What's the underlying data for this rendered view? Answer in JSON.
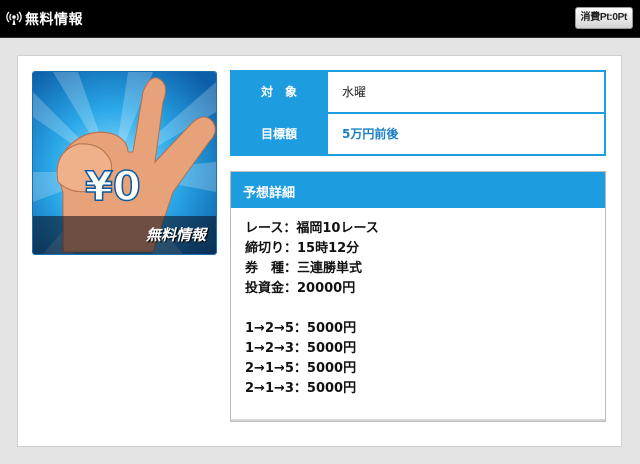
{
  "header": {
    "title": "無料情報",
    "points_badge": "消費Pt:0Pt"
  },
  "image": {
    "caption": "無料情報",
    "hand_text": "¥0"
  },
  "info": {
    "rows": [
      {
        "label": "対　象",
        "value": "水曜"
      },
      {
        "label": "目標額",
        "value": "5万円前後"
      }
    ]
  },
  "detail": {
    "heading": "予想詳細",
    "race": "レース：福岡10レース",
    "deadline": "締切り：15時12分",
    "ticket_type": "券　種：三連勝単式",
    "investment": "投資金：20000円",
    "bets": [
      "1→2→5：5000円",
      "1→2→3：5000円",
      "2→1→5：5000円",
      "2→1→3：5000円"
    ]
  },
  "colors": {
    "accent_blue": "#1d9ce0",
    "value_blue": "#1b7fc4",
    "header_black": "#000000"
  }
}
